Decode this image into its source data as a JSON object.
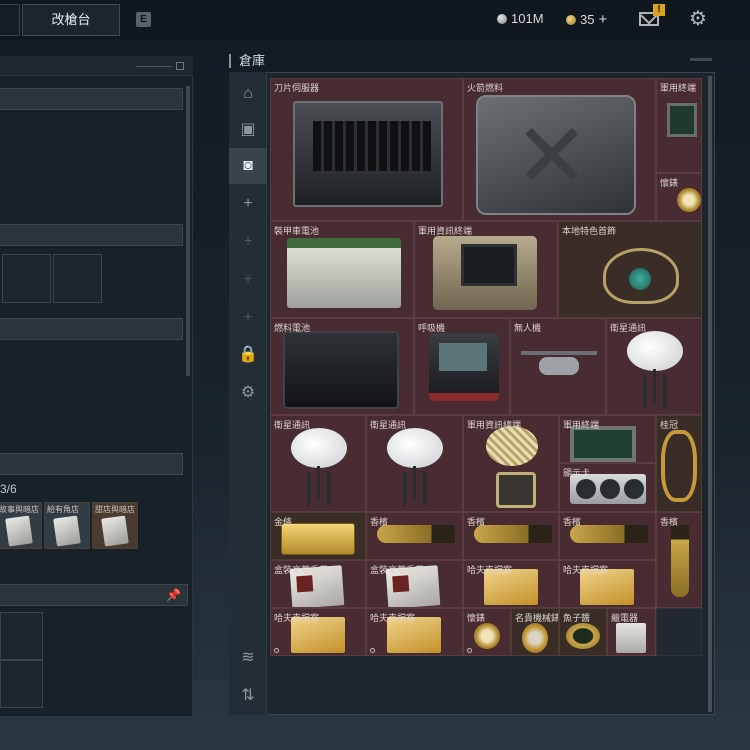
{
  "header": {
    "active_tab": "改槍台",
    "key_hint": "E",
    "currency_silver": "101M",
    "currency_gold": "35",
    "gold_plus": "+",
    "mail_alert": "!"
  },
  "left_panel": {
    "slot_count": "3/6",
    "chips": [
      {
        "label": "故事與暗店"
      },
      {
        "label": "給有角店"
      },
      {
        "label": "甜店與暗店"
      }
    ]
  },
  "storage": {
    "title": "倉庫",
    "items": [
      {
        "label": "刀片伺服器"
      },
      {
        "label": "火箭燃料"
      },
      {
        "label": "軍用終端"
      },
      {
        "label": "懷錶"
      },
      {
        "label": "裝甲車電池"
      },
      {
        "label": "軍用資訊終端"
      },
      {
        "label": "本地特色首飾"
      },
      {
        "label": "燃料電池"
      },
      {
        "label": "呼吸機"
      },
      {
        "label": "無人機"
      },
      {
        "label": "衛星通訊"
      },
      {
        "label": "衛星通訊"
      },
      {
        "label": "衛星通訊"
      },
      {
        "label": "軍用資訊總端"
      },
      {
        "label": "軍用終端"
      },
      {
        "label": "顯示卡"
      },
      {
        "label": "桂冠"
      },
      {
        "label": "金條"
      },
      {
        "label": "香檳"
      },
      {
        "label": "香檳"
      },
      {
        "label": "香檳"
      },
      {
        "label": "香檳"
      },
      {
        "label": "盒裝豪華香菸"
      },
      {
        "label": "盒裝豪華香菸"
      },
      {
        "label": "哈夫克檔案"
      },
      {
        "label": "哈夫克檔案"
      },
      {
        "label": "哈夫克檔案"
      },
      {
        "label": "哈夫克檔案"
      },
      {
        "label": "懷錶"
      },
      {
        "label": "名貴機械錶"
      },
      {
        "label": "魚子醬"
      },
      {
        "label": "繼電器"
      }
    ]
  }
}
